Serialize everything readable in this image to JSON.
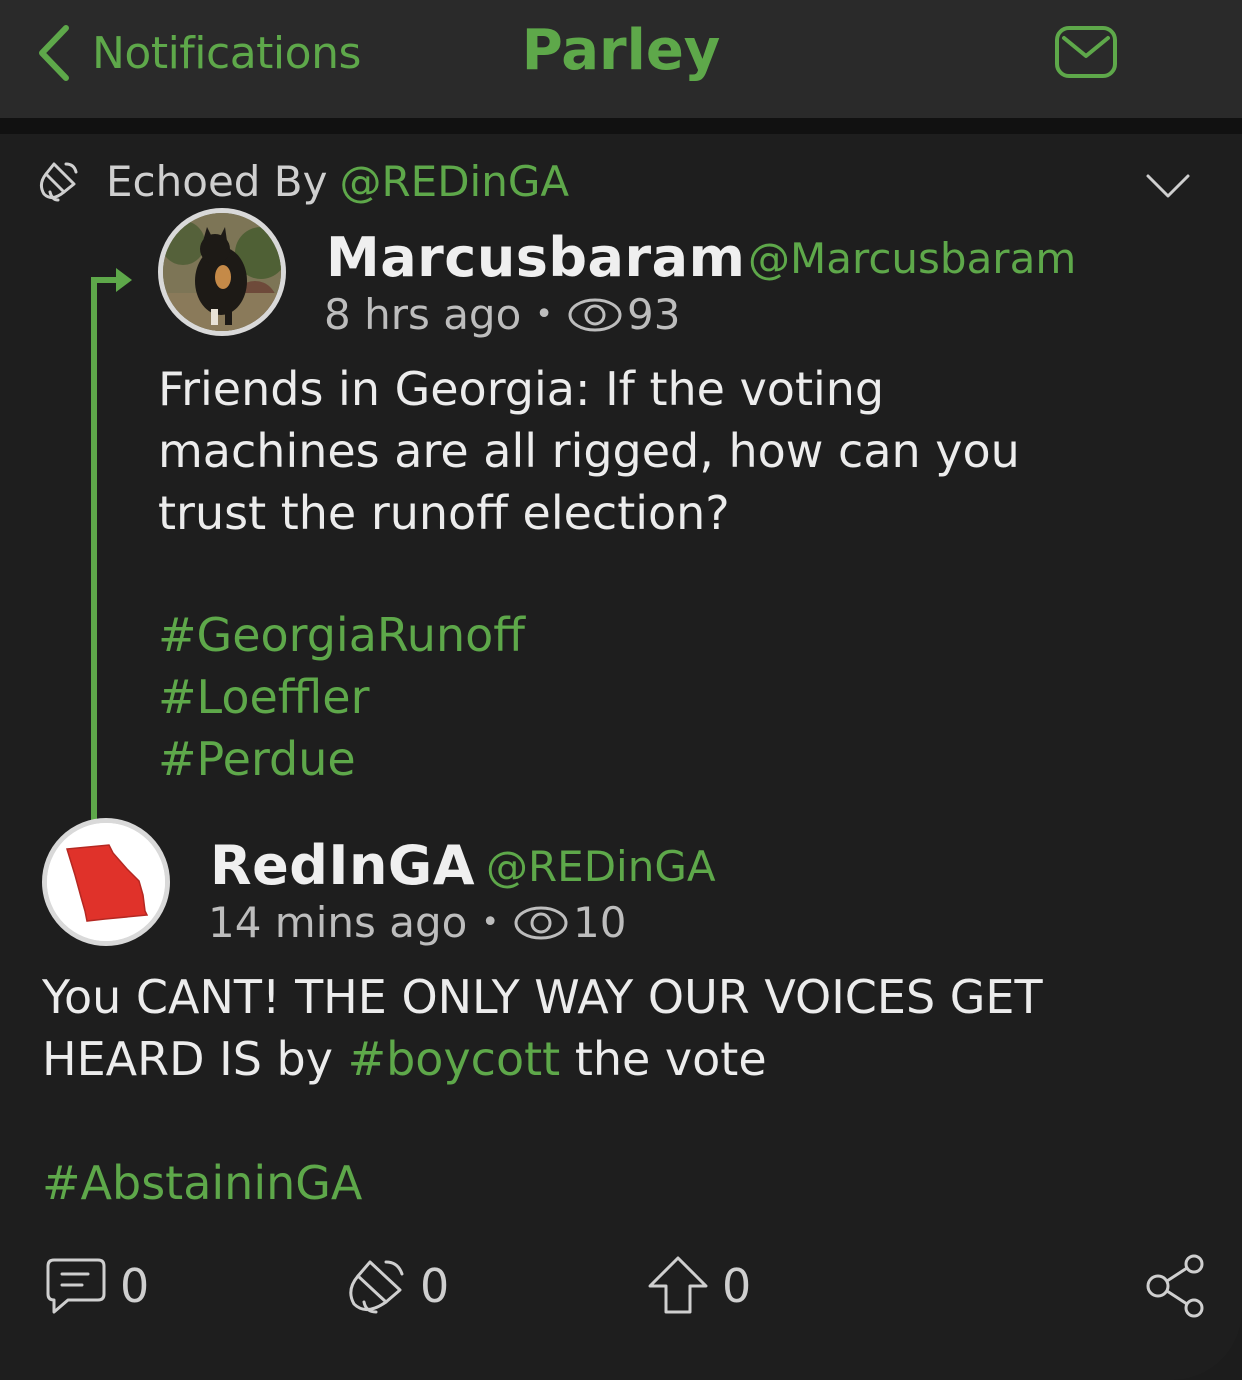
{
  "nav": {
    "back_label": "Notifications",
    "title": "Parley"
  },
  "echo": {
    "label": "Echoed By",
    "handle": "@REDinGA"
  },
  "original_post": {
    "name": "Marcusbaram",
    "handle": "@Marcusbaram",
    "time": "8 hrs ago",
    "views": "93",
    "text_lines": [
      "Friends in Georgia: If the voting",
      "machines are all rigged, how can you",
      "trust the runoff election?"
    ],
    "hashtags": [
      "#GeorgiaRunoff",
      "#Loeffler",
      "#Perdue"
    ]
  },
  "reply_post": {
    "name": "RedInGA",
    "handle": "@REDinGA",
    "time": "14 mins ago",
    "views": "10",
    "line1": "You CANT! THE ONLY WAY OUR VOICES GET",
    "line2_prefix": "HEARD IS by",
    "line2_tag": "#boycott",
    "line2_suffix": "the vote",
    "hashtag": "#AbstaininGA"
  },
  "actions": {
    "comments": "0",
    "echoes": "0",
    "upvotes": "0"
  },
  "colors": {
    "accent": "#5ea84a",
    "background": "#1e1e1e",
    "navbar": "#2a2a2a"
  },
  "icons": [
    "chevron-left-icon",
    "mail-icon",
    "echo-icon",
    "chevron-down-icon",
    "eye-icon",
    "comment-icon",
    "upvote-icon",
    "share-icon"
  ]
}
